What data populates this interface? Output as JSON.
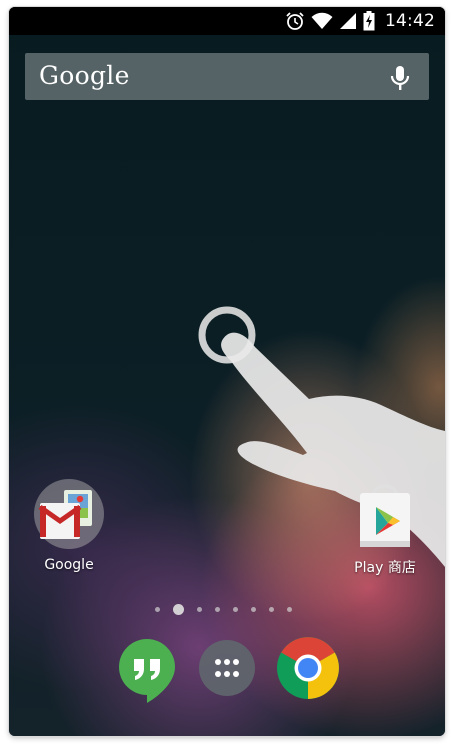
{
  "status_bar": {
    "time": "14:42",
    "icons": [
      "alarm-icon",
      "wifi-icon",
      "signal-icon",
      "battery-charging-icon"
    ]
  },
  "search_bar": {
    "logo_text": "Google",
    "mic_icon": "microphone-icon"
  },
  "gesture_hint": {
    "icon": "hand-tap-icon"
  },
  "home_apps": [
    {
      "label": "Google",
      "icon": "gmail-folder-icon"
    },
    {
      "label": "Play 商店",
      "icon": "play-store-icon"
    }
  ],
  "page_indicator": {
    "pages": 8,
    "current": 2
  },
  "dock": [
    {
      "icon": "hangouts-icon"
    },
    {
      "icon": "app-drawer-icon"
    },
    {
      "icon": "chrome-icon"
    }
  ],
  "colors": {
    "hangouts_green": "#4caf50",
    "status_bar": "#000000",
    "chrome_red": "#db4437",
    "chrome_yellow": "#f4c20d",
    "chrome_green": "#0f9d58",
    "chrome_blue": "#4285f4"
  }
}
